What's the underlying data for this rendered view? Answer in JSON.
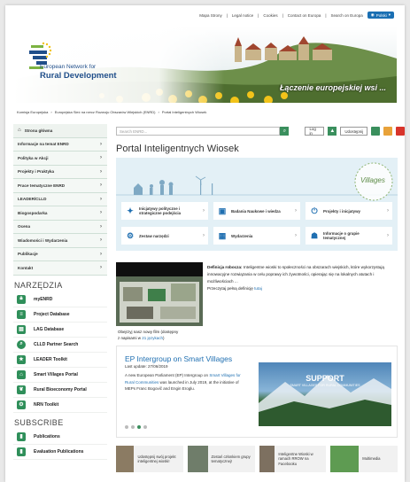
{
  "top_links": [
    "Mapa Strony",
    "Legal notice",
    "Cookies",
    "Contact on Europa",
    "Search on Europa"
  ],
  "lang_label": "Polski",
  "logo": {
    "line1": "European Network for",
    "line2": "Rural Development"
  },
  "slogan": "Łączenie europejskiej wsi ...",
  "breadcrumb": [
    "Komisja Europejska",
    "Europejska Sieć na rzecz Rozwoju Obszarów Wiejskich (ENRD)",
    "Portal Inteligentnych Wiosek"
  ],
  "nav": [
    "Strona główna",
    "Informacje na temat ENRD",
    "Polityka w Akcji",
    "Projekty i Praktyka",
    "Prace tematyczne ENRD",
    "LEADER/CLLD",
    "Biogospodarka",
    "Ocena",
    "Wiadomości i Wydarzenia",
    "Publikacje",
    "Kontakt"
  ],
  "tools_title": "NARZĘDZIA",
  "tools": [
    "myENRD",
    "Project Database",
    "LAG Database",
    "CLLD Partner Search",
    "LEADER Toolkit",
    "Smart Villages Portal",
    "Rural Bioeconomy Portal",
    "NRN Toolkit"
  ],
  "subscribe_title": "SUBSCRIBE",
  "subscribe": [
    "Publications",
    "Evaluation Publications"
  ],
  "search_placeholder": "Search ENRD...",
  "login_label": "Log in",
  "share_label": "Udostępnij",
  "page_title": "Portal Inteligentnych Wiosek",
  "hero_word": "Villages",
  "tiles": [
    "Inicjatywy polityczne i strategiczne podejścia",
    "Badania Naukowe i wiedza",
    "Projekty i inicjatywy",
    "Zestaw narzędzi",
    "Wydarzenia",
    "Informacje o grupie tematycznej"
  ],
  "intro": {
    "bold": "Definicja robocza:",
    "text": " Inteligentne wioski to społeczności na obszarach wiejskich, które wykorzystują innowacyjne rozwiązania w celu poprawy ich żywotności, opierając się na lokalnych atutach i możliwościach ...",
    "more": "Przeczytaj pełną definicję",
    "more_link": "tutaj"
  },
  "caption": {
    "l1": "Obejrzyj nasz nowy film (dostępny",
    "l2": "z napisami w ",
    "l2_link": "21 językach",
    "l2_end": ")"
  },
  "news": {
    "title": "EP Intergroup on Smart Villages",
    "date": "Last update: 27/06/2019",
    "text1": "A new European Parliament (EP) Intergroup on ",
    "link": "Smart Villages for Rural Communities",
    "text2": " was launched in July 2019, at the initiative of MEPs Franc Bogovič and Engin Eroglu.",
    "img_title": "SUPPORT",
    "img_sub": "SMART VILLAGES FOR RURAL COMMUNITIES"
  },
  "bottom_cards": [
    "Udostępnij swój projekt inteligentnej wioski!",
    "Zostań członkiem grupy tematycznej!",
    "Inteligentne Wioski w ramach RROW na Facebooku",
    "Multimedia"
  ],
  "colors": {
    "green": "#3a8f5d",
    "blue": "#1f6fb1",
    "hero_bg": "#e3f0f6"
  }
}
